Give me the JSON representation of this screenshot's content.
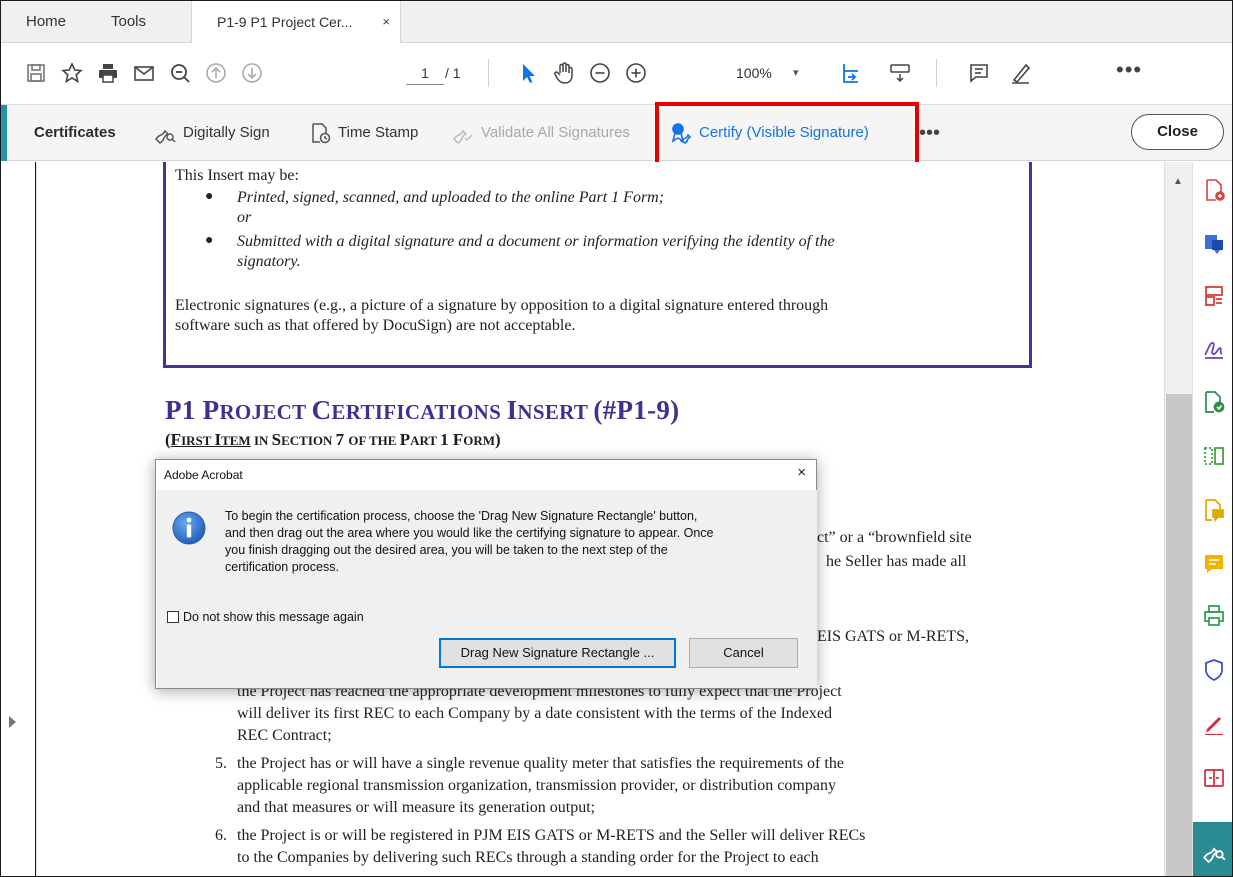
{
  "tabs": {
    "home": "Home",
    "tools": "Tools",
    "document": "P1-9 P1 Project Cer...",
    "document_close": "×"
  },
  "toolbar": {
    "page_current": "1",
    "page_total": "/ 1",
    "zoom": "100%",
    "zoom_caret": "▾",
    "more": "•••"
  },
  "certificates_bar": {
    "title": "Certificates",
    "digitally_sign": "Digitally Sign",
    "time_stamp": "Time Stamp",
    "validate_all": "Validate All Signatures",
    "certify_visible": "Certify (Visible Signature)",
    "more": "•••",
    "close": "Close",
    "accent_color": "#2596a7",
    "highlight_color": "#e40000"
  },
  "document": {
    "insert_intro": "This Insert may be:",
    "bullet1": "Printed, signed, scanned, and uploaded to the online Part 1 Form;",
    "or": "or",
    "bullet2_line1": "Submitted with a digital signature and a document or information verifying the identity of the",
    "bullet2_line2": "signatory.",
    "esig_line1": "Electronic signatures (e.g., a picture of a signature by opposition to a digital signature entered through",
    "esig_line2": "software such as that offered by DocuSign) are not acceptable.",
    "heading_p1": "P1 P",
    "heading_roject": "ROJECT ",
    "heading_c": "C",
    "heading_ertifications": "ERTIFICATIONS ",
    "heading_i": "I",
    "heading_nsert": "NSERT ",
    "heading_tail": "(#P1-9)",
    "sub_open": "(",
    "sub_f": "F",
    "sub_irst": "IRST ",
    "sub_i": "I",
    "sub_tem": "TEM",
    "sub_in": " IN ",
    "sub_s": "S",
    "sub_ection": "ECTION ",
    "sub_7": "7 ",
    "sub_of_the": "OF THE ",
    "sub_p": "P",
    "sub_art": "ART ",
    "sub_1": "1 ",
    "sub_form_f": "F",
    "sub_orm": "ORM",
    "sub_close": ")",
    "frag1": "ct” or a “brownfield site",
    "frag2": "he Seller has made all",
    "frag3": "EIS GATS or M-RETS,",
    "item4_line1": "the Project has reached the appropriate development milestones to fully expect that the Project",
    "item4_line2": "will deliver its first REC to each Company by a date consistent with the terms of the Indexed",
    "item4_line3": "REC Contract;",
    "item5_num": "5.",
    "item5_line1": "the Project has or will have a single revenue quality meter that satisfies the requirements of the",
    "item5_line2": "applicable regional transmission organization, transmission provider, or distribution company",
    "item5_line3": "and that measures or will measure its generation output;",
    "item6_num": "6.",
    "item6_line1": "the Project is or will be registered in PJM EIS GATS or M-RETS and the Seller will deliver RECs",
    "item6_line2": "to the Companies by delivering such RECs through a standing order for the Project to each"
  },
  "dialog": {
    "title": "Adobe Acrobat",
    "close": "×",
    "message_line1": "To begin the certification process, choose the 'Drag New Signature Rectangle' button,",
    "message_line2": "and then drag out the area where you would like the certifying signature to appear. Once",
    "message_line3": "you finish dragging out the desired area, you will be taken to the next step of the",
    "message_line4": "certification process.",
    "checkbox_label": "Do not show this message again",
    "primary_button": "Drag New Signature Rectangle ...",
    "cancel_button": "Cancel"
  }
}
